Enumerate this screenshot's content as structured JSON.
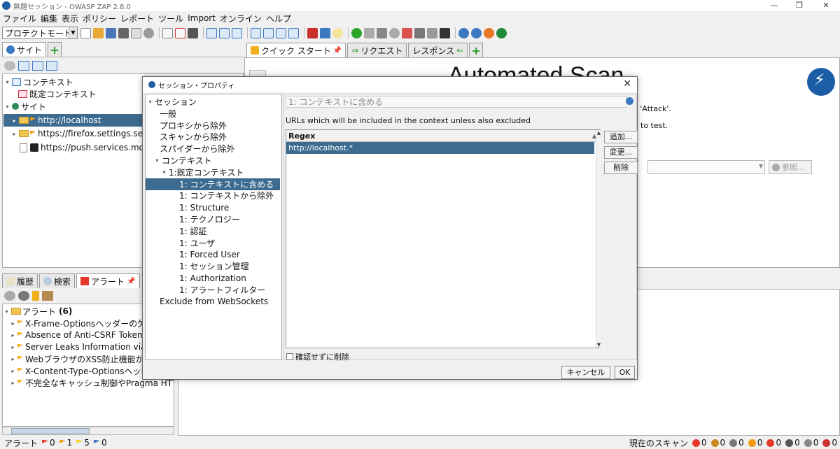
{
  "window": {
    "title": "無題セッション - OWASP ZAP 2.8.0",
    "controls": [
      "—",
      "❐",
      "✕"
    ]
  },
  "menubar": {
    "items": [
      "ファイル",
      "編集",
      "表示",
      "ポリシー",
      "レポート",
      "ツール",
      "Import",
      "オンライン",
      "ヘルプ"
    ]
  },
  "toolbar": {
    "mode": "プロテクトモード"
  },
  "sites_panel": {
    "tab_label": "サイト",
    "tree": {
      "contexts": "コンテキスト",
      "default_context": "既定コンテキスト",
      "sites": "サイト",
      "site_items": [
        "http://localhost",
        "https://firefox.settings.services",
        "https://push.services.mozilla."
      ]
    }
  },
  "workspace": {
    "tabs": [
      "クイック スタート",
      "リクエスト",
      "レスポンス"
    ],
    "heading": "Automated Scan",
    "snippet_attack": "s 'Attack'.",
    "snippet_test": "to test.",
    "browse_label": "参照..."
  },
  "alerts_panel": {
    "tabs": [
      "履歴",
      "検索",
      "アラート"
    ],
    "root_label": "アラート",
    "root_count": "(6)",
    "items": [
      "X-Frame-Optionsヘッダーの欠如",
      "Absence of Anti-CSRF Tokens",
      "Server Leaks Information via \"X-Po",
      "WebブラウザのXSS防止機能が有",
      "X-Content-Type-Optionsヘッダの",
      "不完全なキャッシュ制御やPragma HTTP"
    ]
  },
  "statusbar": {
    "alerts_label": "アラート",
    "alert_counts": [
      "0",
      "1",
      "5",
      "0"
    ],
    "scans_label": "現在のスキャン",
    "scan_counts": [
      "0",
      "0",
      "0",
      "0",
      "0",
      "0",
      "0",
      "0"
    ]
  },
  "dialog": {
    "title": "セッション・プロパティ",
    "tree": [
      {
        "label": "セッション",
        "indent": 0,
        "twisty": "▾"
      },
      {
        "label": "一般",
        "indent": 1
      },
      {
        "label": "プロキシから除外",
        "indent": 1
      },
      {
        "label": "スキャンから除外",
        "indent": 1
      },
      {
        "label": "スパイダーから除外",
        "indent": 1
      },
      {
        "label": "コンテキスト",
        "indent": 1,
        "twisty": "▾"
      },
      {
        "label": "1:既定コンテキスト",
        "indent": 2,
        "twisty": "▾"
      },
      {
        "label": "1: コンテキストに含める",
        "indent": 3,
        "selected": true
      },
      {
        "label": "1: コンテキストから除外",
        "indent": 3
      },
      {
        "label": "1: Structure",
        "indent": 3
      },
      {
        "label": "1: テクノロジー",
        "indent": 3
      },
      {
        "label": "1: 認証",
        "indent": 3
      },
      {
        "label": "1: ユーザ",
        "indent": 3
      },
      {
        "label": "1: Forced User",
        "indent": 3
      },
      {
        "label": "1: セッション管理",
        "indent": 3
      },
      {
        "label": "1: Authorization",
        "indent": 3
      },
      {
        "label": "1: アラートフィルター",
        "indent": 3
      },
      {
        "label": "Exclude from WebSockets",
        "indent": 1
      }
    ],
    "panel_title": "1: コンテキストに含める",
    "description": "URLs which will be included in the context unless also excluded",
    "table": {
      "header": "Regex",
      "rows": [
        "http://localhost.*"
      ]
    },
    "buttons": {
      "add": "追加...",
      "modify": "変更...",
      "remove": "削除",
      "confirm_remove": "確認せずに削除",
      "cancel": "キャンセル",
      "ok": "OK"
    }
  }
}
